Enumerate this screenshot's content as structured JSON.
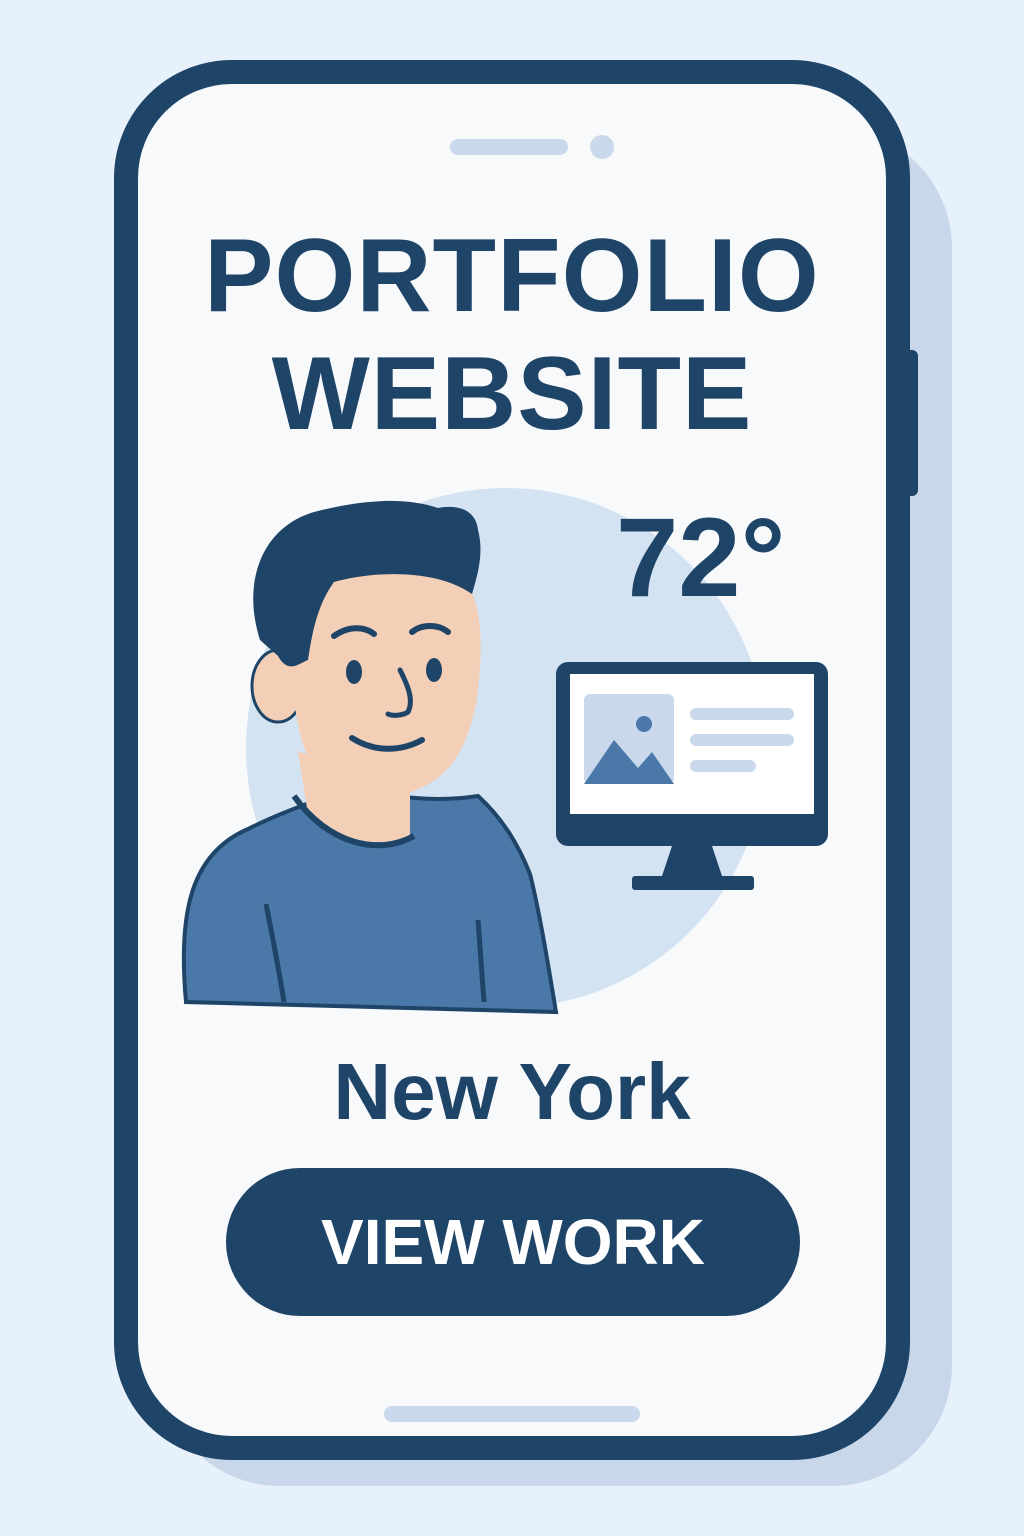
{
  "header": {
    "title_line1": "PORTFOLIO",
    "title_line2": "WEBSITE"
  },
  "weather": {
    "temperature": "72°",
    "city": "New York"
  },
  "cta": {
    "label": "VIEW WORK"
  },
  "icons": {
    "avatar": "person-illustration",
    "monitor": "monitor-icon",
    "image": "image-placeholder-icon"
  },
  "colors": {
    "primary": "#1e4468",
    "background": "#e6f1fc",
    "accent_light": "#d4e3f2",
    "shirt": "#4a78a8",
    "skin": "#f4cfb7"
  }
}
